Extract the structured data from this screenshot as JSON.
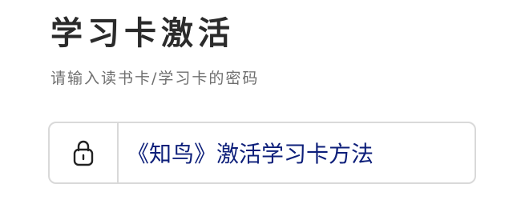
{
  "header": {
    "title": "学习卡激活",
    "subtitle": "请输入读书卡/学习卡的密码"
  },
  "code_field": {
    "icon": "lock-icon",
    "value": "《知鸟》激活学习卡方法"
  },
  "colors": {
    "title": "#2b2b2b",
    "subtitle": "#6f6f6f",
    "field_border": "#d9d9d9",
    "field_text": "#0d1f7a"
  }
}
